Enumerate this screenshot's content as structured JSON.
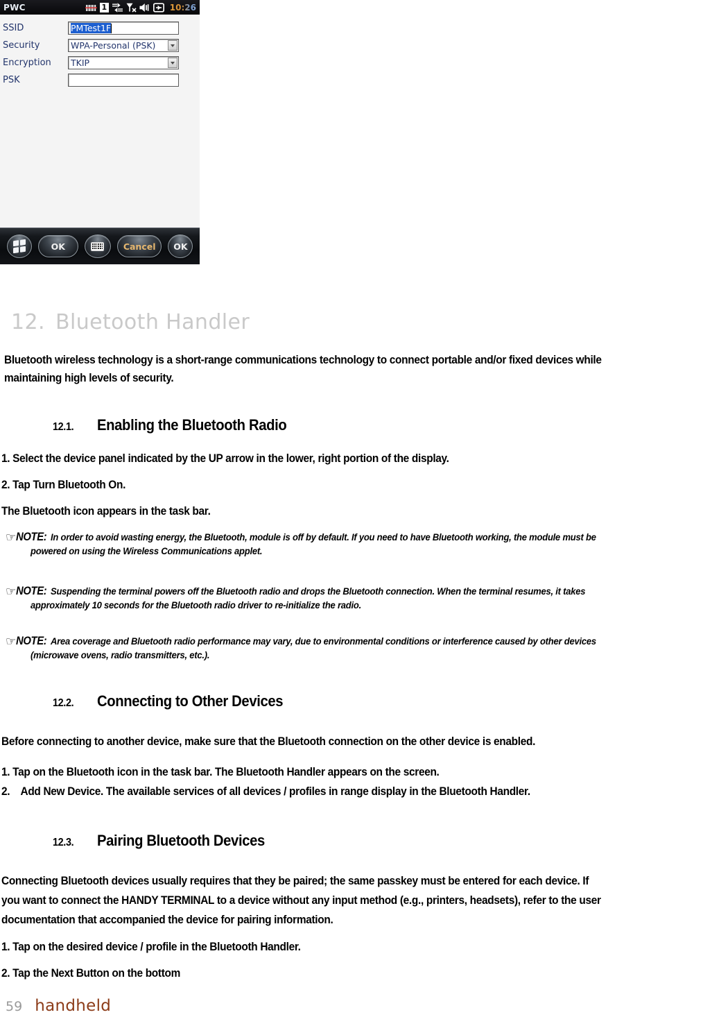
{
  "device": {
    "titlebar": {
      "app_name": "PWC",
      "time": "10:26",
      "queue_count": "1",
      "icons": [
        "barcode-scanner-icon",
        "queue-count-icon",
        "data-transfer-icon",
        "signal-none-icon",
        "volume-icon",
        "connection-icon"
      ]
    },
    "form": {
      "fields": [
        {
          "label": "SSID",
          "type": "text",
          "value": "PMTest1F",
          "selected": true
        },
        {
          "label": "Security",
          "type": "dropdown",
          "value": "WPA-Personal (PSK)"
        },
        {
          "label": "Encryption",
          "type": "dropdown",
          "value": "TKIP"
        },
        {
          "label": "PSK",
          "type": "text",
          "value": ""
        }
      ]
    },
    "toolbar": {
      "start_label": "start-icon",
      "ok_label": "OK",
      "keyboard_label": "keyboard-icon",
      "cancel_label": "Cancel",
      "ok2_label": "OK"
    }
  },
  "document": {
    "chapter": {
      "number": "12.",
      "title": "Bluetooth Handler"
    },
    "intro": "Bluetooth wireless technology is a short-range communications technology to connect portable and/or fixed devices while maintaining high levels of security.",
    "sections": [
      {
        "number": "12.1.",
        "title": "Enabling the Bluetooth Radio",
        "steps": [
          "1. Select the device panel indicated by the UP arrow in the lower, right portion of the display.",
          "2. Tap Turn Bluetooth On.",
          "The Bluetooth icon appears in the task bar."
        ]
      },
      {
        "number": "12.2.",
        "title": "Connecting to Other Devices",
        "lead": "Before connecting to another device, make sure that the Bluetooth connection on the other device is enabled.",
        "steps": [
          "1. Tap on the Bluetooth icon in the task bar. The Bluetooth Handler appears on the screen.",
          "2.    Add New Device. The available services of all devices / profiles in range display in the Bluetooth Handler."
        ]
      },
      {
        "number": "12.3.",
        "title": "Pairing Bluetooth Devices",
        "lead_line1": "Connecting Bluetooth devices usually requires that they be paired; the same passkey must be entered for each device. If",
        "lead_line2": "you want to connect the HANDY TERMINAL to a device without any input method (e.g., printers, headsets), refer to the user",
        "lead_line3": "documentation that accompanied the device for pairing information.",
        "steps": [
          "1. Tap on the desired device / profile in the Bluetooth Handler.",
          "2. Tap the Next Button on the bottom"
        ]
      }
    ],
    "notes": [
      {
        "label": "NOTE:",
        "line1": "In order to avoid wasting energy, the Bluetooth, module is off by default. If you need to have Bluetooth working, the module must be",
        "line2": "powered on using the Wireless Communications applet."
      },
      {
        "label": "NOTE:",
        "line1": "Suspending the terminal powers off the Bluetooth radio and drops the Bluetooth connection. When the terminal resumes, it takes",
        "line2": "approximately 10 seconds for the Bluetooth radio driver to re-initialize the radio."
      },
      {
        "label": "NOTE:",
        "line1": "Area coverage and Bluetooth radio performance may vary, due to environmental conditions or interference caused by other devices",
        "line2": "(microwave ovens, radio transmitters, etc.)."
      }
    ],
    "intro_line1": "Bluetooth wireless technology is a short-range communications technology to connect portable and/or fixed devices while",
    "intro_line2": "maintaining high levels of security.",
    "footer": {
      "page_number": "59",
      "brand": "handheld"
    }
  },
  "colors": {
    "heading_gray": "#c9c9c9",
    "brand_brown": "#8c3c19",
    "page_gray": "#9a9a9a",
    "field_text_blue": "#22346b",
    "selection_blue": "#1d5fd0"
  }
}
